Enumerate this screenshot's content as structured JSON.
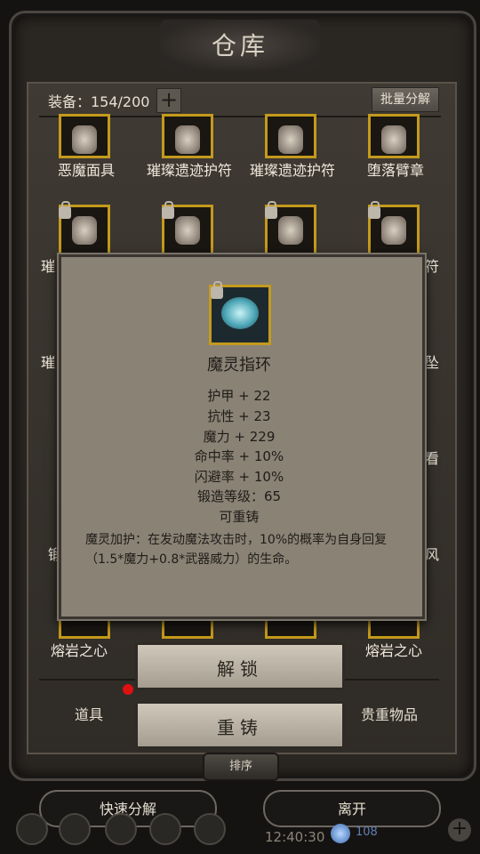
{
  "header": {
    "title": "仓库"
  },
  "equipment": {
    "label": "装备：154/200",
    "add_label": "+",
    "bulk_decompose": "批量分解"
  },
  "grid": {
    "row1": [
      "恶魔面具",
      "璀璨遗迹护符",
      "璀璨遗迹护符",
      "堕落臂章"
    ],
    "row2_partial_left": "璀",
    "row2_partial_right": "符",
    "row3_partial_left": "璀",
    "row3_partial_right": "坠",
    "row5_partial_left": "锻",
    "row5_partial_right": "风",
    "row4_partial_right": "看",
    "row6": [
      "熔岩之心",
      "熔岩之心"
    ]
  },
  "popup": {
    "name": "魔灵指环",
    "stats": [
      "护甲 + 22",
      "抗性 + 23",
      "魔力 + 229",
      "命中率 + 10%",
      "闪避率 + 10%",
      "锻造等级：65",
      "可重铸"
    ],
    "description": "魔灵加护：在发动魔法攻击时，10%的概率为自身回复（1.5*魔力+0.8*武器威力）的生命。"
  },
  "actions": {
    "unlock": "解锁",
    "reforge": "重铸"
  },
  "tabs": {
    "items": "道具",
    "valuables": "贵重物品",
    "sort": "排序"
  },
  "bottom": {
    "quick_decompose": "快速分解",
    "leave": "离开"
  },
  "status": {
    "time": "12:40:30",
    "gems": "108"
  },
  "colors": {
    "slot_border": "#c49a1c",
    "popup_bg": "#8a8275",
    "notification": "#dd1111"
  }
}
